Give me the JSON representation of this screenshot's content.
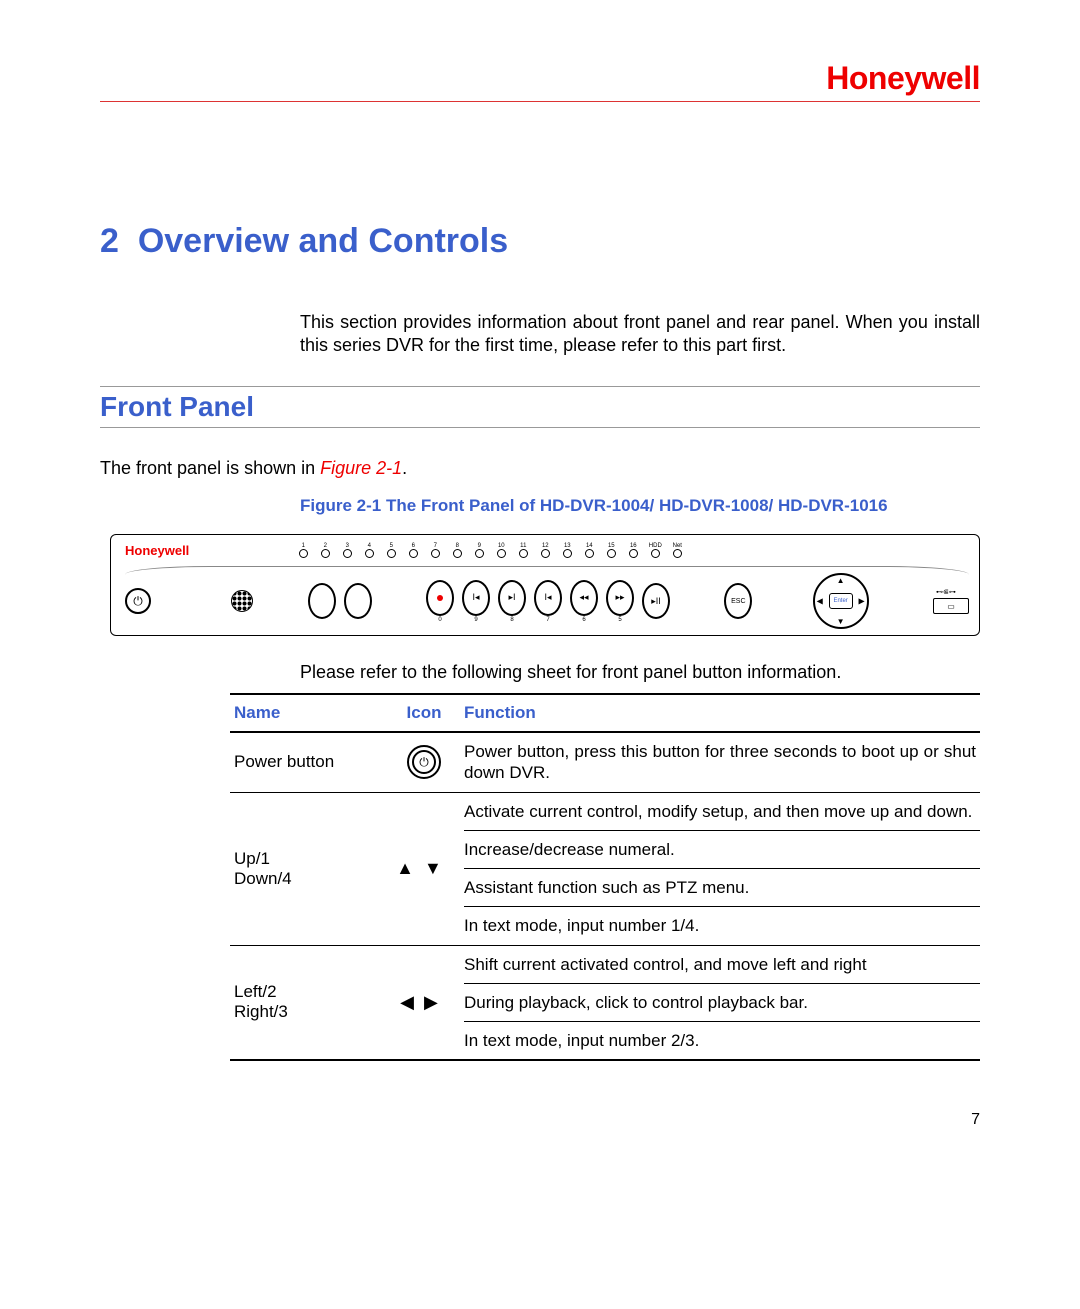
{
  "brand": "Honeywell",
  "section": {
    "number": "2",
    "title": "Overview and Controls",
    "intro": "This section provides information about front panel and rear panel. When you install this series DVR for the first time, please refer to this part first."
  },
  "subsection": {
    "title": "Front Panel",
    "lead_in_pre": "The front panel is shown in ",
    "lead_in_ref": "Figure 2-1",
    "lead_in_post": ".",
    "figure_caption": "Figure 2-1 The Front Panel of HD-DVR-1004/ HD-DVR-1008/ HD-DVR-1016",
    "after_figure": "Please refer to the following sheet for front panel button information."
  },
  "panel": {
    "brand": "Honeywell",
    "led_labels": [
      "1",
      "2",
      "3",
      "4",
      "5",
      "6",
      "7",
      "8",
      "9",
      "10",
      "11",
      "12",
      "13",
      "14",
      "15",
      "16",
      "HDD",
      "Net"
    ],
    "enter_label": "Enter",
    "esc_label": "ESC",
    "sub_numbers": [
      "0",
      "9",
      "8",
      "7",
      "6",
      "5"
    ],
    "usb_label": "⊷⋐⊶"
  },
  "table": {
    "headers": {
      "name": "Name",
      "icon": "Icon",
      "func": "Function"
    },
    "rows": [
      {
        "name": "Power button",
        "icon": "power",
        "functions": [
          "Power button, press this button for three seconds to boot up or shut down DVR."
        ]
      },
      {
        "name": "Up/1\nDown/4",
        "icon": "up-down",
        "functions": [
          "Activate current control, modify setup, and then move up and down.",
          "Increase/decrease numeral.",
          "Assistant function such as PTZ menu.",
          "In text mode, input number 1/4."
        ]
      },
      {
        "name": "Left/2\nRight/3",
        "icon": "left-right",
        "functions": [
          "Shift current activated control, and move left and right",
          "During playback, click to control playback bar.",
          "In text mode, input number 2/3."
        ]
      }
    ]
  },
  "page_number": "7"
}
